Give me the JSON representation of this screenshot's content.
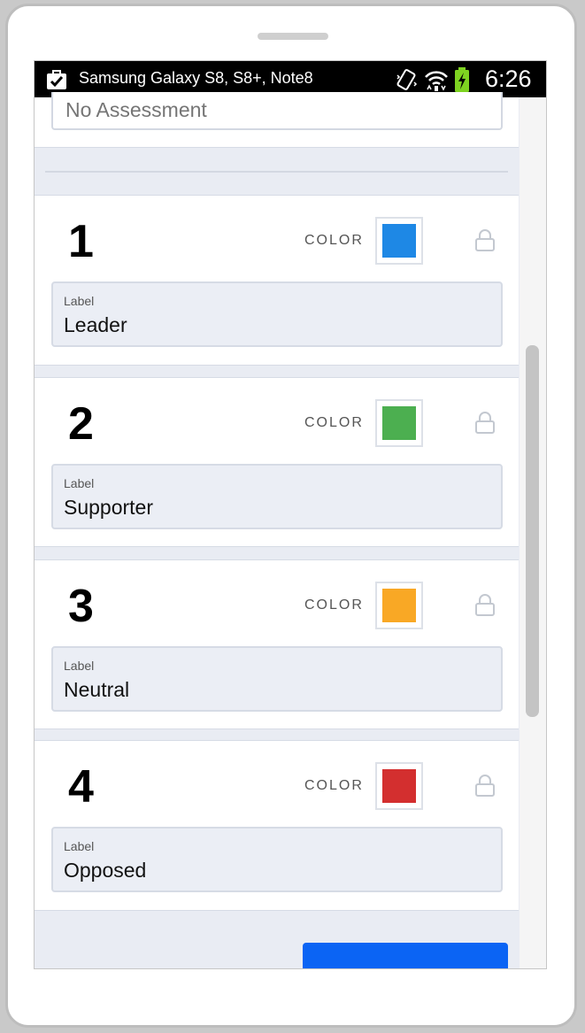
{
  "statusbar": {
    "device_name": "Samsung Galaxy S8, S8+, Note8",
    "time": "6:26",
    "icons": [
      "briefcase-check-icon",
      "vibrate-icon",
      "wifi-icon",
      "battery-charging-icon"
    ]
  },
  "assessment": {
    "placeholder": "No Assessment"
  },
  "levels": [
    {
      "number": "1",
      "color_label": "COLOR",
      "color": "#1e88e5",
      "field_caption": "Label",
      "field_value": "Leader",
      "lock_icon": "lock-icon"
    },
    {
      "number": "2",
      "color_label": "COLOR",
      "color": "#4caf50",
      "field_caption": "Label",
      "field_value": "Supporter",
      "lock_icon": "lock-icon"
    },
    {
      "number": "3",
      "color_label": "COLOR",
      "color": "#f9a825",
      "field_caption": "Label",
      "field_value": "Neutral",
      "lock_icon": "lock-icon"
    },
    {
      "number": "4",
      "color_label": "COLOR",
      "color": "#d32f2f",
      "field_caption": "Label",
      "field_value": "Opposed",
      "lock_icon": "lock-icon"
    }
  ],
  "colors": {
    "accent_button": "#0b64f4",
    "background": "#e9ecf3"
  }
}
